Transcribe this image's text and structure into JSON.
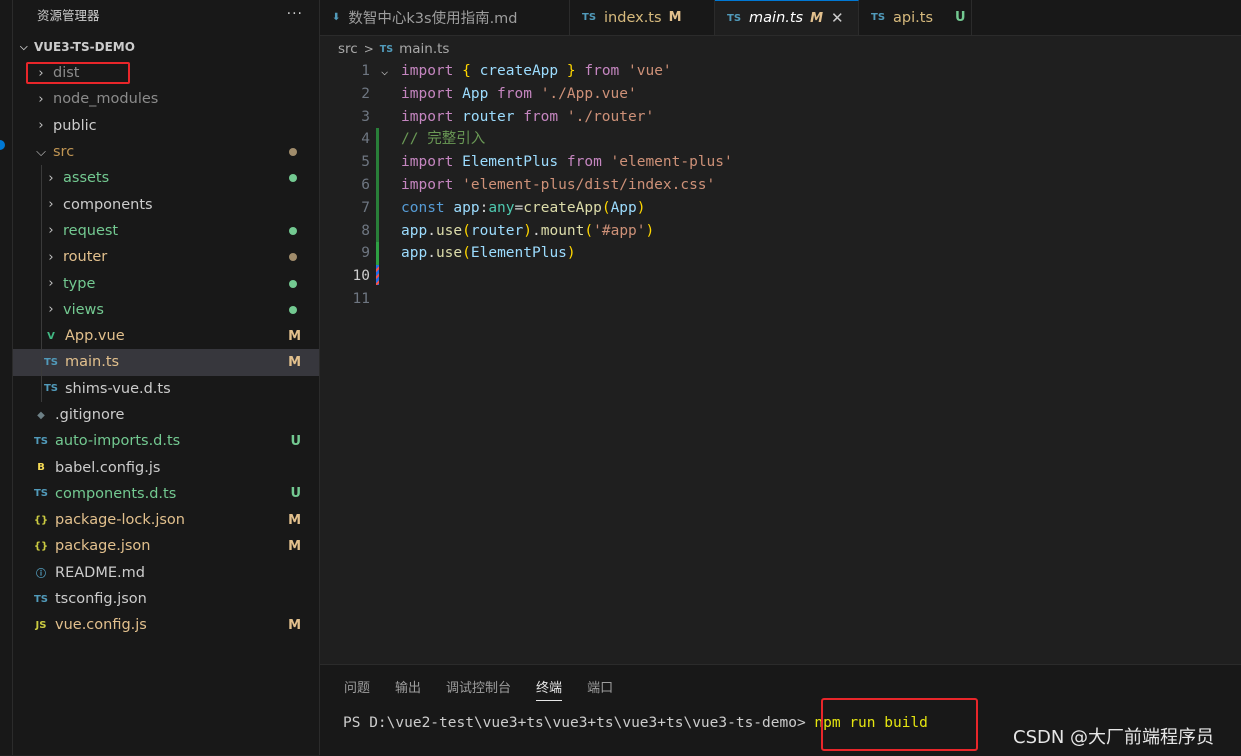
{
  "sidebar": {
    "title": "资源管理器",
    "more": "···",
    "root": "VUE3-TS-DEMO",
    "items": [
      {
        "label": "dist",
        "type": "folder",
        "indent": 0,
        "color": "#8b8b8b"
      },
      {
        "label": "node_modules",
        "type": "folder",
        "indent": 0,
        "color": "#8b8b8b"
      },
      {
        "label": "public",
        "type": "folder",
        "indent": 0,
        "color": "#cccccc"
      },
      {
        "label": "src",
        "type": "folder-open",
        "indent": 0,
        "color": "#c09553",
        "dot": "#a08c6b"
      },
      {
        "label": "assets",
        "type": "folder",
        "indent": 1,
        "color": "#73c991",
        "dot": "#73c991"
      },
      {
        "label": "components",
        "type": "folder",
        "indent": 1,
        "color": "#cccccc"
      },
      {
        "label": "request",
        "type": "folder",
        "indent": 1,
        "color": "#73c991",
        "dot": "#73c991"
      },
      {
        "label": "router",
        "type": "folder",
        "indent": 1,
        "color": "#e2c08d",
        "dot": "#a08c6b"
      },
      {
        "label": "type",
        "type": "folder",
        "indent": 1,
        "color": "#73c991",
        "dot": "#73c991"
      },
      {
        "label": "views",
        "type": "folder",
        "indent": 1,
        "color": "#73c991",
        "dot": "#73c991"
      },
      {
        "label": "App.vue",
        "type": "vue",
        "indent": 1,
        "color": "#e2c08d",
        "status": "M"
      },
      {
        "label": "main.ts",
        "type": "ts",
        "indent": 1,
        "color": "#e2c08d",
        "status": "M",
        "selected": true
      },
      {
        "label": "shims-vue.d.ts",
        "type": "ts",
        "indent": 1,
        "color": "#cccccc"
      },
      {
        "label": ".gitignore",
        "type": "git",
        "indent": 0,
        "color": "#cccccc"
      },
      {
        "label": "auto-imports.d.ts",
        "type": "ts",
        "indent": 0,
        "color": "#73c991",
        "status": "U"
      },
      {
        "label": "babel.config.js",
        "type": "babel",
        "indent": 0,
        "color": "#cccccc"
      },
      {
        "label": "components.d.ts",
        "type": "ts",
        "indent": 0,
        "color": "#73c991",
        "status": "U"
      },
      {
        "label": "package-lock.json",
        "type": "json",
        "indent": 0,
        "color": "#e2c08d",
        "status": "M"
      },
      {
        "label": "package.json",
        "type": "json",
        "indent": 0,
        "color": "#e2c08d",
        "status": "M"
      },
      {
        "label": "README.md",
        "type": "info",
        "indent": 0,
        "color": "#cccccc"
      },
      {
        "label": "tsconfig.json",
        "type": "tsconfig",
        "indent": 0,
        "color": "#cccccc"
      },
      {
        "label": "vue.config.js",
        "type": "js",
        "indent": 0,
        "color": "#e2c08d",
        "status": "M"
      }
    ]
  },
  "tabs": [
    {
      "label": "数智中心k3s使用指南.md",
      "icon": "download-icon",
      "status": "",
      "active": false
    },
    {
      "label": "index.ts",
      "icon": "TS",
      "status": "M",
      "active": false,
      "status_color": "#e2c08d"
    },
    {
      "label": "main.ts",
      "icon": "TS",
      "status": "M",
      "active": true,
      "status_color": "#e2c08d"
    },
    {
      "label": "api.ts",
      "icon": "TS",
      "status": "U",
      "active": false,
      "status_color": "#73c991"
    }
  ],
  "breadcrumb": {
    "folder": "src",
    "sep": ">",
    "icon": "TS",
    "file": "main.ts"
  },
  "editor": {
    "line_numbers": [
      "1",
      "2",
      "3",
      "4",
      "5",
      "6",
      "7",
      "8",
      "9",
      "10",
      "11"
    ],
    "lines": [
      [
        [
          "kw2",
          "import "
        ],
        [
          "br1",
          "{ "
        ],
        [
          "var",
          "createApp "
        ],
        [
          "br1",
          "} "
        ],
        [
          "kw2",
          "from "
        ],
        [
          "str",
          "'vue'"
        ]
      ],
      [
        [
          "kw2",
          "import "
        ],
        [
          "var",
          "App "
        ],
        [
          "kw2",
          "from "
        ],
        [
          "str",
          "'./App.vue'"
        ]
      ],
      [
        [
          "kw2",
          "import "
        ],
        [
          "var",
          "router "
        ],
        [
          "kw2",
          "from "
        ],
        [
          "str",
          "'./router'"
        ]
      ],
      [
        [
          "cmt",
          "// 完整引入"
        ]
      ],
      [
        [
          "kw2",
          "import "
        ],
        [
          "var",
          "ElementPlus "
        ],
        [
          "kw2",
          "from "
        ],
        [
          "str",
          "'element-plus'"
        ]
      ],
      [
        [
          "kw2",
          "import "
        ],
        [
          "str",
          "'element-plus/dist/index.css'"
        ]
      ],
      [
        [
          "kw",
          "const "
        ],
        [
          "var",
          "app"
        ],
        [
          "plain",
          ":"
        ],
        [
          "cls",
          "any"
        ],
        [
          "plain",
          "="
        ],
        [
          "fn",
          "createApp"
        ],
        [
          "br1",
          "("
        ],
        [
          "var",
          "App"
        ],
        [
          "br1",
          ")"
        ]
      ],
      [
        [
          "var",
          "app"
        ],
        [
          "plain",
          "."
        ],
        [
          "fn",
          "use"
        ],
        [
          "br1",
          "("
        ],
        [
          "var",
          "router"
        ],
        [
          "br1",
          ")"
        ],
        [
          "plain",
          "."
        ],
        [
          "fn",
          "mount"
        ],
        [
          "br1",
          "("
        ],
        [
          "str",
          "'#app'"
        ],
        [
          "br1",
          ")"
        ]
      ],
      [
        [
          "var",
          "app"
        ],
        [
          "plain",
          "."
        ],
        [
          "fn",
          "use"
        ],
        [
          "br1",
          "("
        ],
        [
          "var",
          "ElementPlus"
        ],
        [
          "br1",
          ")"
        ]
      ],
      [],
      []
    ]
  },
  "panel": {
    "tabs": [
      "问题",
      "输出",
      "调试控制台",
      "终端",
      "端口"
    ],
    "active_tab": "终端",
    "prompt": "PS D:\\vue2-test\\vue3+ts\\vue3+ts\\vue3+ts\\vue3-ts-demo> ",
    "command": "npm run build"
  },
  "watermark": "CSDN @大厂前端程序员"
}
